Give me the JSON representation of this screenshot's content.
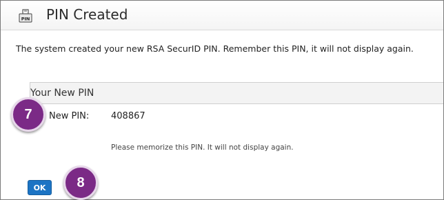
{
  "dialog": {
    "title": "PIN Created",
    "message": "The system created your new RSA SecurID PIN. Remember this PIN, it will not display again.",
    "section_title": "Your New PIN",
    "field_label": "New PIN:",
    "field_value": "408867",
    "hint": "Please memorize this PIN. It will not display again.",
    "ok_label": "OK",
    "icon": "pin-icon"
  },
  "annotations": {
    "step_a": "7",
    "step_b": "8"
  },
  "colors": {
    "accent": "#1c74c4",
    "badge": "#7b2a86"
  }
}
